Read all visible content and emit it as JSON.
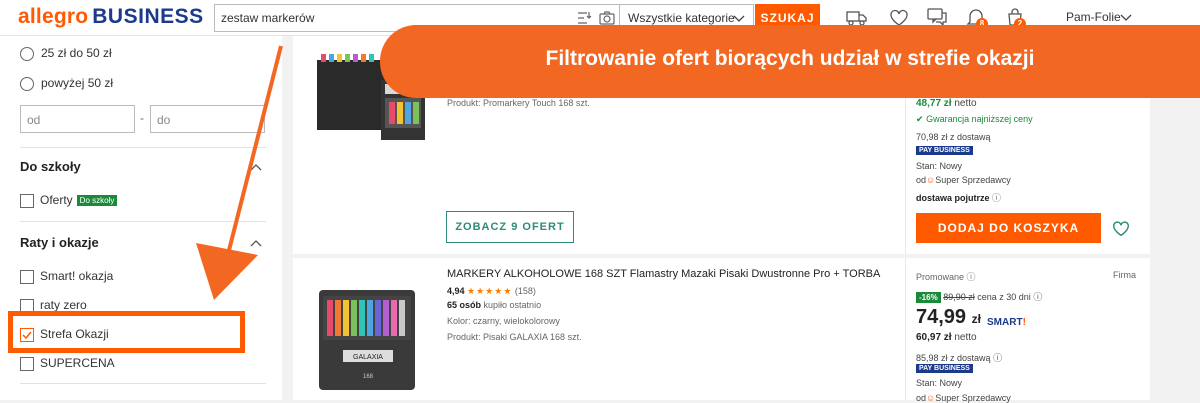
{
  "header": {
    "logo_part1": "allegro",
    "logo_part2": "BUSINESS",
    "search_value": "zestaw markerów",
    "category": "Wszystkie kategorie",
    "search_button": "SZUKAJ",
    "notifications_badge": "8",
    "cart_badge": "2",
    "user_name": "Pam-Folie"
  },
  "sidebar": {
    "price_options": [
      "25 zł do 50 zł",
      "powyżej 50 zł"
    ],
    "price_from_placeholder": "od",
    "price_to_placeholder": "do",
    "price_dash": "-",
    "school_section_title": "Do szkoły",
    "school_option": "Oferty",
    "school_tag": "Do szkoły",
    "installments_title": "Raty i okazje",
    "installment_options": [
      {
        "label": "Smart! okazja",
        "checked": false
      },
      {
        "label": "raty zero",
        "checked": false
      },
      {
        "label": "Strefa Okazji",
        "checked": true
      },
      {
        "label": "SUPERCENA",
        "checked": false
      }
    ]
  },
  "banner": {
    "text": "Filtrowanie ofert biorących udział w strefie okazji"
  },
  "products": [
    {
      "product_line": "Produkt: Promarkery Touch 168 szt.",
      "offers_button": "ZOBACZ 9 OFERT",
      "net_price": "48,77 zł",
      "net_label": "netto",
      "guarantee": "Gwarancja najniższej ceny",
      "with_delivery": "70,98 zł z dostawą",
      "pay_business": "PAY BUSINESS",
      "state": "Stan: Nowy",
      "seller": "od",
      "seller_label": "Super Sprzedawcy",
      "delivery": "dostawa pojutrze",
      "add_to_cart": "DODAJ DO KOSZYKA"
    },
    {
      "title": "MARKERY ALKOHOLOWE 168 SZT Flamastry Mazaki Pisaki Dwustronne Pro + TORBA",
      "rating": "4,94",
      "rating_count": "(158)",
      "buyers": "65 osób",
      "buyers_suffix": "kupiło ostatnio",
      "color": "Kolor: czarny, wielokolorowy",
      "product_line": "Produkt: Pisaki GALAXIA 168 szt.",
      "promoted": "Promowane",
      "firm": "Firma",
      "discount": "-16%",
      "old_price": "89,90 zł",
      "old_price_note": "cena z 30 dni",
      "price_main": "74,99",
      "price_currency": "zł",
      "smart": "SMART",
      "net_price": "60,97 zł",
      "net_label": "netto",
      "with_delivery": "85,98 zł z dostawą",
      "pay_business": "PAY BUSINESS",
      "state": "Stan: Nowy",
      "seller": "od",
      "seller_label": "Super Sprzedawcy",
      "box_text": "GALAXIA",
      "box_count": "168"
    }
  ],
  "colors": {
    "accent": "#ff5a00",
    "banner": "#f26722",
    "brand_blue": "#1b3a8c",
    "green": "#1a8a3a",
    "teal": "#2e8b7a"
  }
}
